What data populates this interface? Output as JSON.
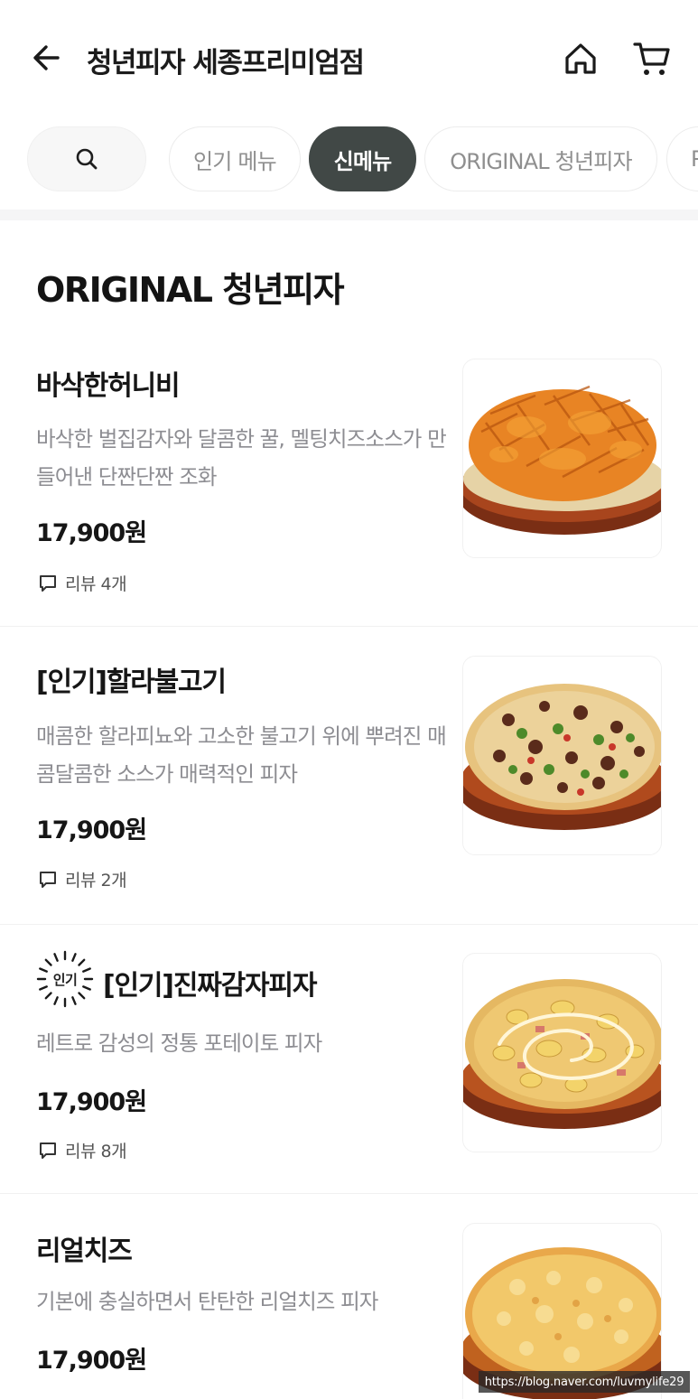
{
  "header": {
    "store_title": "청년피자 세종프리미엄점",
    "back_icon": "arrow-left-icon",
    "home_icon": "home-icon",
    "cart_icon": "cart-icon"
  },
  "tabs": [
    {
      "label": "인기 메뉴",
      "active": false
    },
    {
      "label": "신메뉴",
      "active": true
    },
    {
      "label": "ORIGINAL 청년피자",
      "active": false
    },
    {
      "label": "P",
      "active": false
    }
  ],
  "section": {
    "title": "ORIGINAL 청년피자"
  },
  "items": [
    {
      "name": "바삭한허니비",
      "desc": "바삭한 벌집감자와 달콤한 꿀, 멜팅치즈소스가 만들어낸 단짠단짠 조화",
      "price": "17,900원",
      "review": "리뷰 4개",
      "image": "waffle-fries-pizza"
    },
    {
      "name": "[인기]할라불고기",
      "desc": "매콤한 할라피뇨와 고소한 불고기 위에 뿌려진 매콤달콤한 소스가 매력적인 피자",
      "price": "17,900원",
      "review": "리뷰 2개",
      "image": "jalapeno-bulgogi-pizza"
    },
    {
      "name": "[인기]진짜감자피자",
      "desc": "레트로 감성의 정통 포테이토 피자",
      "price": "17,900원",
      "review": "리뷰 8개",
      "badge": "인기",
      "image": "potato-pizza"
    },
    {
      "name": "리얼치즈",
      "desc": "기본에 충실하면서 탄탄한 리얼치즈 피자",
      "price": "17,900원",
      "image": "cheese-pizza"
    }
  ],
  "watermark": "https://blog.naver.com/luvmylife29",
  "colors": {
    "active_tab": "#414846",
    "desc_text": "#8d8d92",
    "crust": "#8a3a1a"
  }
}
